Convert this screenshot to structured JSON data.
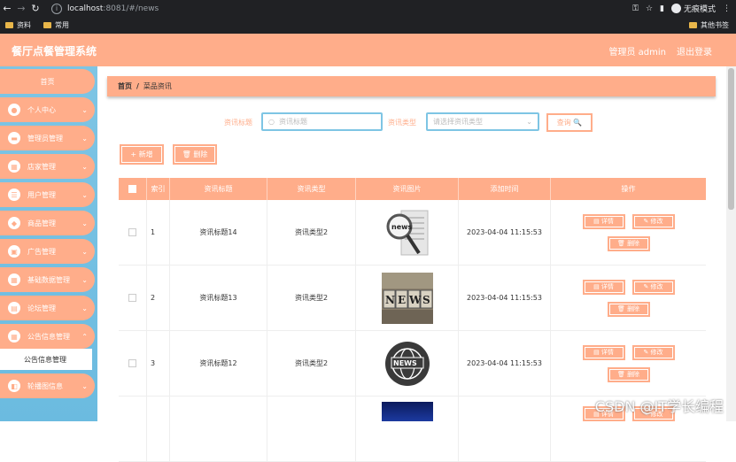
{
  "browser": {
    "url_host": "localhost",
    "url_path": ":8081/#/news",
    "profile_label": "无痕模式",
    "bookmarks": [
      "资料",
      "常用"
    ],
    "other_bookmarks": "其他书签"
  },
  "app": {
    "title": "餐厅点餐管理系统",
    "user_label": "管理员 admin",
    "logout_label": "退出登录"
  },
  "sidebar": {
    "home": "首页",
    "items": [
      {
        "label": "个人中心"
      },
      {
        "label": "管理员管理"
      },
      {
        "label": "店家管理"
      },
      {
        "label": "用户管理"
      },
      {
        "label": "商品管理"
      },
      {
        "label": "广告管理"
      },
      {
        "label": "基础数据管理"
      },
      {
        "label": "论坛管理"
      },
      {
        "label": "公告信息管理"
      },
      {
        "label": "轮播图信息"
      }
    ],
    "sub_item": "公告信息管理"
  },
  "breadcrumb": {
    "home": "首页",
    "sep": "/",
    "current": "菜品资讯"
  },
  "search": {
    "title_label": "资讯标题",
    "title_placeholder": "资讯标题",
    "type_label": "资讯类型",
    "type_placeholder": "请选择资讯类型",
    "query_label": "查询 🔍"
  },
  "actions": {
    "add_label": "+ 新增",
    "delete_label": "🗑 删除"
  },
  "table": {
    "headers": [
      "索引",
      "资讯标题",
      "资讯类型",
      "资讯图片",
      "添加时间",
      "操作"
    ],
    "rows": [
      {
        "index": "1",
        "title": "资讯标题14",
        "type": "资讯类型2",
        "time": "2023-04-04 11:15:53"
      },
      {
        "index": "2",
        "title": "资讯标题13",
        "type": "资讯类型2",
        "time": "2023-04-04 11:15:53"
      },
      {
        "index": "3",
        "title": "资讯标题12",
        "type": "资讯类型2",
        "time": "2023-04-04 11:15:53"
      }
    ],
    "op_labels": {
      "detail": "详情",
      "edit": "修改",
      "delete": "删除"
    }
  },
  "watermark": "CSDN @IT学长编程",
  "colors": {
    "accent": "#ffad8a",
    "sidebar": "#7ec5e4"
  }
}
